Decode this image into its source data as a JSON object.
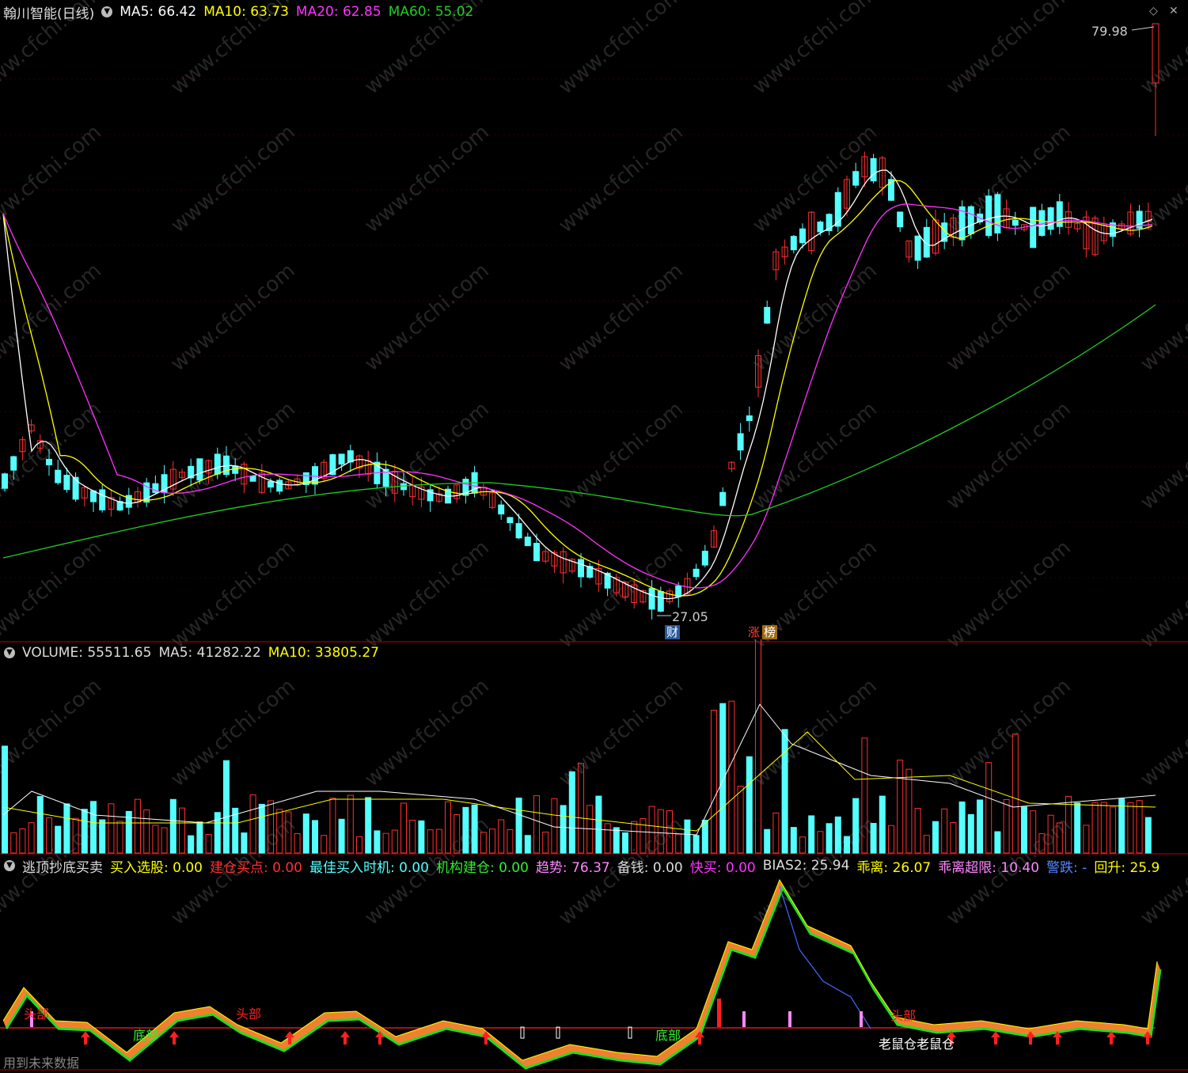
{
  "price_panel": {
    "title": "翰川智能(日线)",
    "ma5": "MA5: 66.42",
    "ma10": "MA10: 63.73",
    "ma20": "MA20: 62.85",
    "ma60": "MA60: 55.02",
    "high_label": "79.98",
    "low_label": "27.05",
    "badge_cai": "财",
    "badge_zhang": "涨",
    "badge_bang": "榜"
  },
  "volume_panel": {
    "volume": "VOLUME: 55511.65",
    "ma5": "MA5: 41282.22",
    "ma10": "MA10: 33805.27"
  },
  "indicator_panel": {
    "name": "逃顶抄底买卖",
    "items": [
      {
        "label": "买入选股: 0.00",
        "color": "#ffff00"
      },
      {
        "label": "建仓买点: 0.00",
        "color": "#ff3030"
      },
      {
        "label": "最佳买入时机: 0.00",
        "color": "#55ffff"
      },
      {
        "label": "机构建仓: 0.00",
        "color": "#33ee33"
      },
      {
        "label": "趋势: 76.37",
        "color": "#ff88ff"
      },
      {
        "label": "备钱: 0.00",
        "color": "#dddddd"
      },
      {
        "label": "快买: 0.00",
        "color": "#ff33ff"
      },
      {
        "label": "BIAS2: 25.94",
        "color": "#dddddd"
      },
      {
        "label": "乖离: 26.07",
        "color": "#ffff00"
      },
      {
        "label": "乖离超限: 10.40",
        "color": "#ff88ff"
      },
      {
        "label": "警跌: -",
        "color": "#5588ff"
      },
      {
        "label": "回升: 25.9",
        "color": "#ffff00"
      }
    ],
    "labels": {
      "top1": "头部",
      "top2": "头部",
      "top3": "头部",
      "bottom1": "底部",
      "bottom2": "底部",
      "laoshu": "老鼠仓",
      "laoshu2": "老鼠仓"
    },
    "footer": "用到未来数据"
  },
  "colors": {
    "up": "#ff3030",
    "down": "#55ffff",
    "ma5": "#ffffff",
    "ma10": "#ffff00",
    "ma20": "#ff33ff",
    "ma60": "#22cc22",
    "separator": "#c00000",
    "watermark": "#262626"
  },
  "watermark": "www.cfchi.com"
}
